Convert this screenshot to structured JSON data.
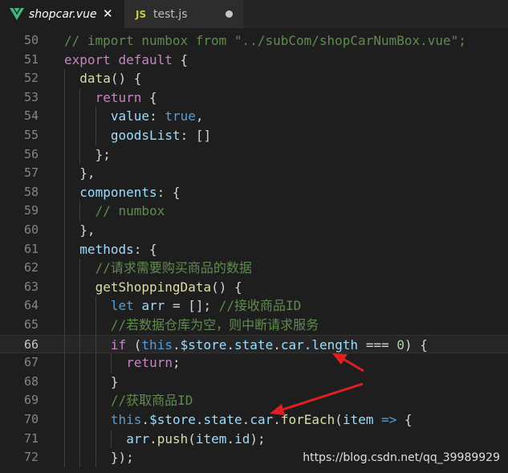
{
  "tabs": [
    {
      "label": "shopcar.vue",
      "icon": "vue-icon",
      "close": "✕",
      "active": true
    },
    {
      "label": "test.js",
      "icon_text": "JS",
      "active": false
    }
  ],
  "lines": [
    {
      "n": "50",
      "i": 0,
      "t": [
        [
          "cm",
          "// import numbox from \"../subCom/shopCarNumBox.vue\";"
        ]
      ]
    },
    {
      "n": "51",
      "i": 0,
      "t": [
        [
          "kc",
          "export"
        ],
        [
          "pl",
          " "
        ],
        [
          "kc",
          "default"
        ],
        [
          "pl",
          " {"
        ]
      ]
    },
    {
      "n": "52",
      "i": 1,
      "t": [
        [
          "fn",
          "data"
        ],
        [
          "pl",
          "() {"
        ]
      ]
    },
    {
      "n": "53",
      "i": 2,
      "t": [
        [
          "kc",
          "return"
        ],
        [
          "pl",
          " {"
        ]
      ]
    },
    {
      "n": "54",
      "i": 3,
      "t": [
        [
          "pr",
          "value"
        ],
        [
          "pl",
          ": "
        ],
        [
          "kw",
          "true"
        ],
        [
          "pl",
          ","
        ]
      ]
    },
    {
      "n": "55",
      "i": 3,
      "t": [
        [
          "pr",
          "goodsList"
        ],
        [
          "pl",
          ": []"
        ]
      ]
    },
    {
      "n": "56",
      "i": 2,
      "t": [
        [
          "pl",
          "};"
        ]
      ]
    },
    {
      "n": "57",
      "i": 1,
      "t": [
        [
          "pl",
          "},"
        ]
      ]
    },
    {
      "n": "58",
      "i": 1,
      "t": [
        [
          "pr",
          "components"
        ],
        [
          "pl",
          ": {"
        ]
      ]
    },
    {
      "n": "59",
      "i": 2,
      "t": [
        [
          "cm",
          "// numbox"
        ]
      ]
    },
    {
      "n": "60",
      "i": 1,
      "t": [
        [
          "pl",
          "},"
        ]
      ]
    },
    {
      "n": "61",
      "i": 1,
      "t": [
        [
          "pr",
          "methods"
        ],
        [
          "pl",
          ": {"
        ]
      ]
    },
    {
      "n": "62",
      "i": 2,
      "t": [
        [
          "cm",
          "//请求需要购买商品的数据"
        ]
      ]
    },
    {
      "n": "63",
      "i": 2,
      "t": [
        [
          "fn",
          "getShoppingData"
        ],
        [
          "pl",
          "() {"
        ]
      ]
    },
    {
      "n": "64",
      "i": 3,
      "t": [
        [
          "kw",
          "let"
        ],
        [
          "pl",
          " "
        ],
        [
          "pr",
          "arr"
        ],
        [
          "pl",
          " = []; "
        ],
        [
          "cm",
          "//接收商品ID"
        ]
      ]
    },
    {
      "n": "65",
      "i": 3,
      "t": [
        [
          "cm",
          "//若数据仓库为空，则中断请求服务"
        ]
      ]
    },
    {
      "n": "66",
      "i": 3,
      "t": [
        [
          "kc",
          "if"
        ],
        [
          "pl",
          " ("
        ],
        [
          "kw",
          "this"
        ],
        [
          "pl",
          "."
        ],
        [
          "pr",
          "$store"
        ],
        [
          "pl",
          "."
        ],
        [
          "pr",
          "state"
        ],
        [
          "pl",
          "."
        ],
        [
          "pr",
          "car"
        ],
        [
          "pl",
          "."
        ],
        [
          "pr",
          "length"
        ],
        [
          "pl",
          " === "
        ],
        [
          "nu",
          "0"
        ],
        [
          "pl",
          ") {"
        ]
      ],
      "current": true
    },
    {
      "n": "67",
      "i": 4,
      "t": [
        [
          "kc",
          "return"
        ],
        [
          "pl",
          ";"
        ]
      ]
    },
    {
      "n": "68",
      "i": 3,
      "t": [
        [
          "pl",
          "}"
        ]
      ]
    },
    {
      "n": "69",
      "i": 3,
      "t": [
        [
          "cm",
          "//获取商品ID"
        ]
      ]
    },
    {
      "n": "70",
      "i": 3,
      "t": [
        [
          "kw",
          "this"
        ],
        [
          "pl",
          "."
        ],
        [
          "pr",
          "$store"
        ],
        [
          "pl",
          "."
        ],
        [
          "pr",
          "state"
        ],
        [
          "pl",
          "."
        ],
        [
          "pr",
          "car"
        ],
        [
          "pl",
          "."
        ],
        [
          "fn",
          "forEach"
        ],
        [
          "pl",
          "("
        ],
        [
          "pr",
          "item"
        ],
        [
          "pl",
          " "
        ],
        [
          "kw",
          "=>"
        ],
        [
          "pl",
          " {"
        ]
      ]
    },
    {
      "n": "71",
      "i": 4,
      "t": [
        [
          "pr",
          "arr"
        ],
        [
          "pl",
          "."
        ],
        [
          "fn",
          "push"
        ],
        [
          "pl",
          "("
        ],
        [
          "pr",
          "item"
        ],
        [
          "pl",
          "."
        ],
        [
          "pr",
          "id"
        ],
        [
          "pl",
          ");"
        ]
      ]
    },
    {
      "n": "72",
      "i": 3,
      "t": [
        [
          "pl",
          "});"
        ]
      ]
    }
  ],
  "watermark": "https://blog.csdn.net/qq_39989929",
  "colors": {
    "annotation_arrow": "#e02020",
    "background": "#1e1e1e"
  }
}
